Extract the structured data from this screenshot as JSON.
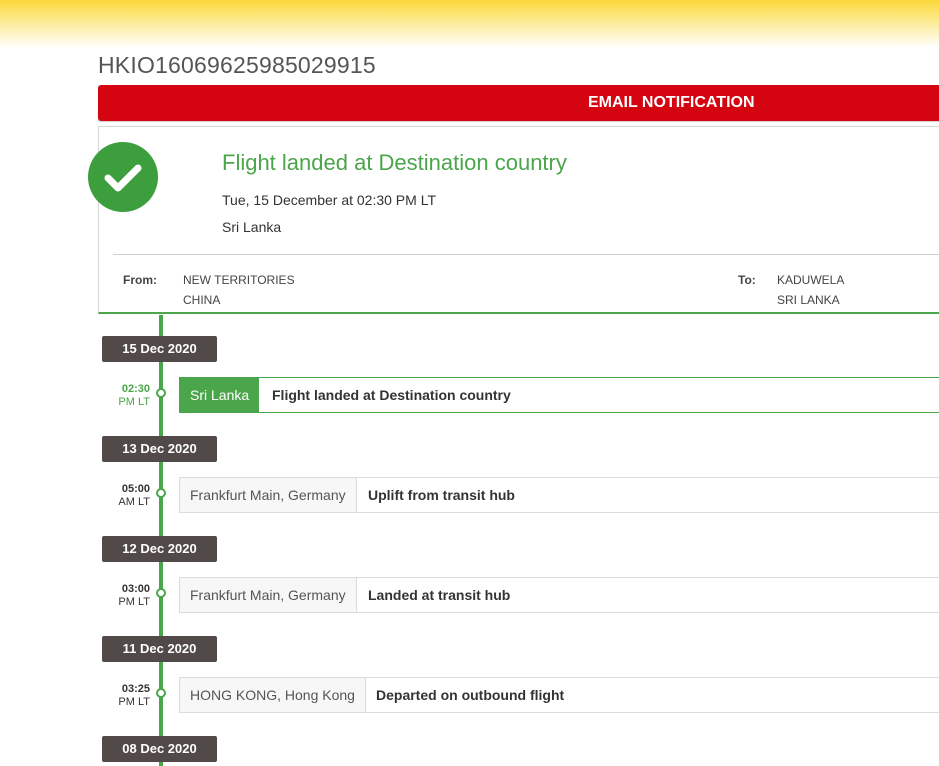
{
  "shipment": {
    "tracking_number": "HKIO16069625985029915",
    "email_notification_label": "EMAIL NOTIFICATION"
  },
  "status": {
    "icon": "check-icon",
    "title": "Flight landed at Destination country",
    "date": "Tue, 15 December at 02:30 PM LT",
    "location": "Sri Lanka",
    "color": "#4ba54a"
  },
  "route": {
    "from_label": "From:",
    "from_line1": "NEW TERRITORIES",
    "from_line2": "CHINA",
    "to_label": "To:",
    "to_line1": "KADUWELA",
    "to_line2": "SRI LANKA"
  },
  "timeline": [
    {
      "date": "15 Dec 2020",
      "time": "02:30",
      "ampm": "PM LT",
      "location": "Sri Lanka",
      "description": "Flight landed at Destination country"
    },
    {
      "date": "13 Dec 2020",
      "time": "05:00",
      "ampm": "AM LT",
      "location": "Frankfurt Main, Germany",
      "description": "Uplift from transit hub"
    },
    {
      "date": "12 Dec 2020",
      "time": "03:00",
      "ampm": "PM LT",
      "location": "Frankfurt Main, Germany",
      "description": "Landed at transit hub"
    },
    {
      "date": "11 Dec 2020",
      "time": "03:25",
      "ampm": "PM LT",
      "location": "HONG KONG, Hong Kong",
      "description": "Departed on outbound flight"
    },
    {
      "date": "08 Dec 2020"
    }
  ],
  "colors": {
    "brand_red": "#d40511",
    "brand_yellow": "#fcd83a",
    "accent_green": "#4ba54a",
    "date_chip": "#524a48"
  }
}
